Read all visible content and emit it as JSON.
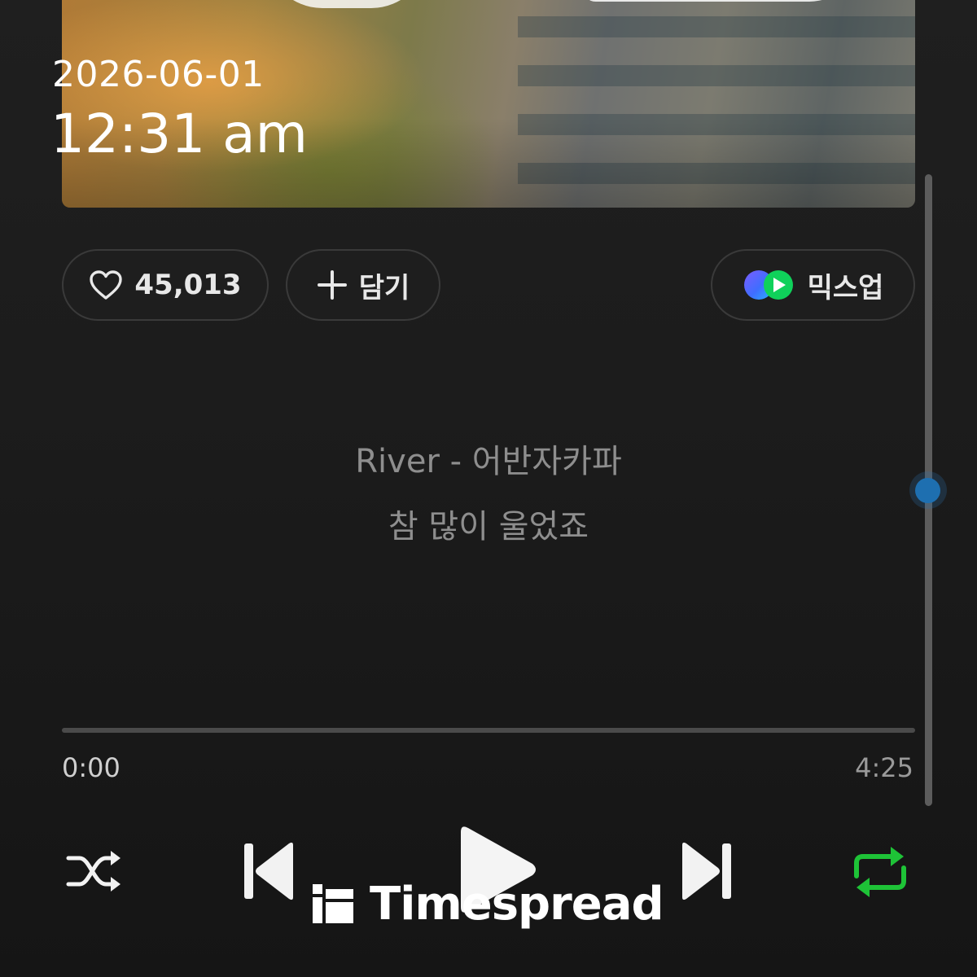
{
  "status": {
    "date": "2026-06-01",
    "time": "12:31 am"
  },
  "actions": {
    "like_count": "45,013",
    "add_label": "담기",
    "mixup_label": "믹스업"
  },
  "lyrics": {
    "line1": "River - 어반자카파",
    "line2": "참 많이 울었죠"
  },
  "playback": {
    "elapsed": "0:00",
    "total": "4:25",
    "progress": 0
  },
  "controls": {
    "shuffle_icon": "shuffle-icon",
    "prev_icon": "skip-previous-icon",
    "play_icon": "play-icon",
    "next_icon": "skip-next-icon",
    "repeat_icon": "repeat-icon",
    "repeat_active_color": "#1ec337"
  },
  "watermark": {
    "text": "Timespread"
  },
  "colors": {
    "background": "#1b1b1b",
    "scroll_thumb": "#1e6fb0"
  }
}
